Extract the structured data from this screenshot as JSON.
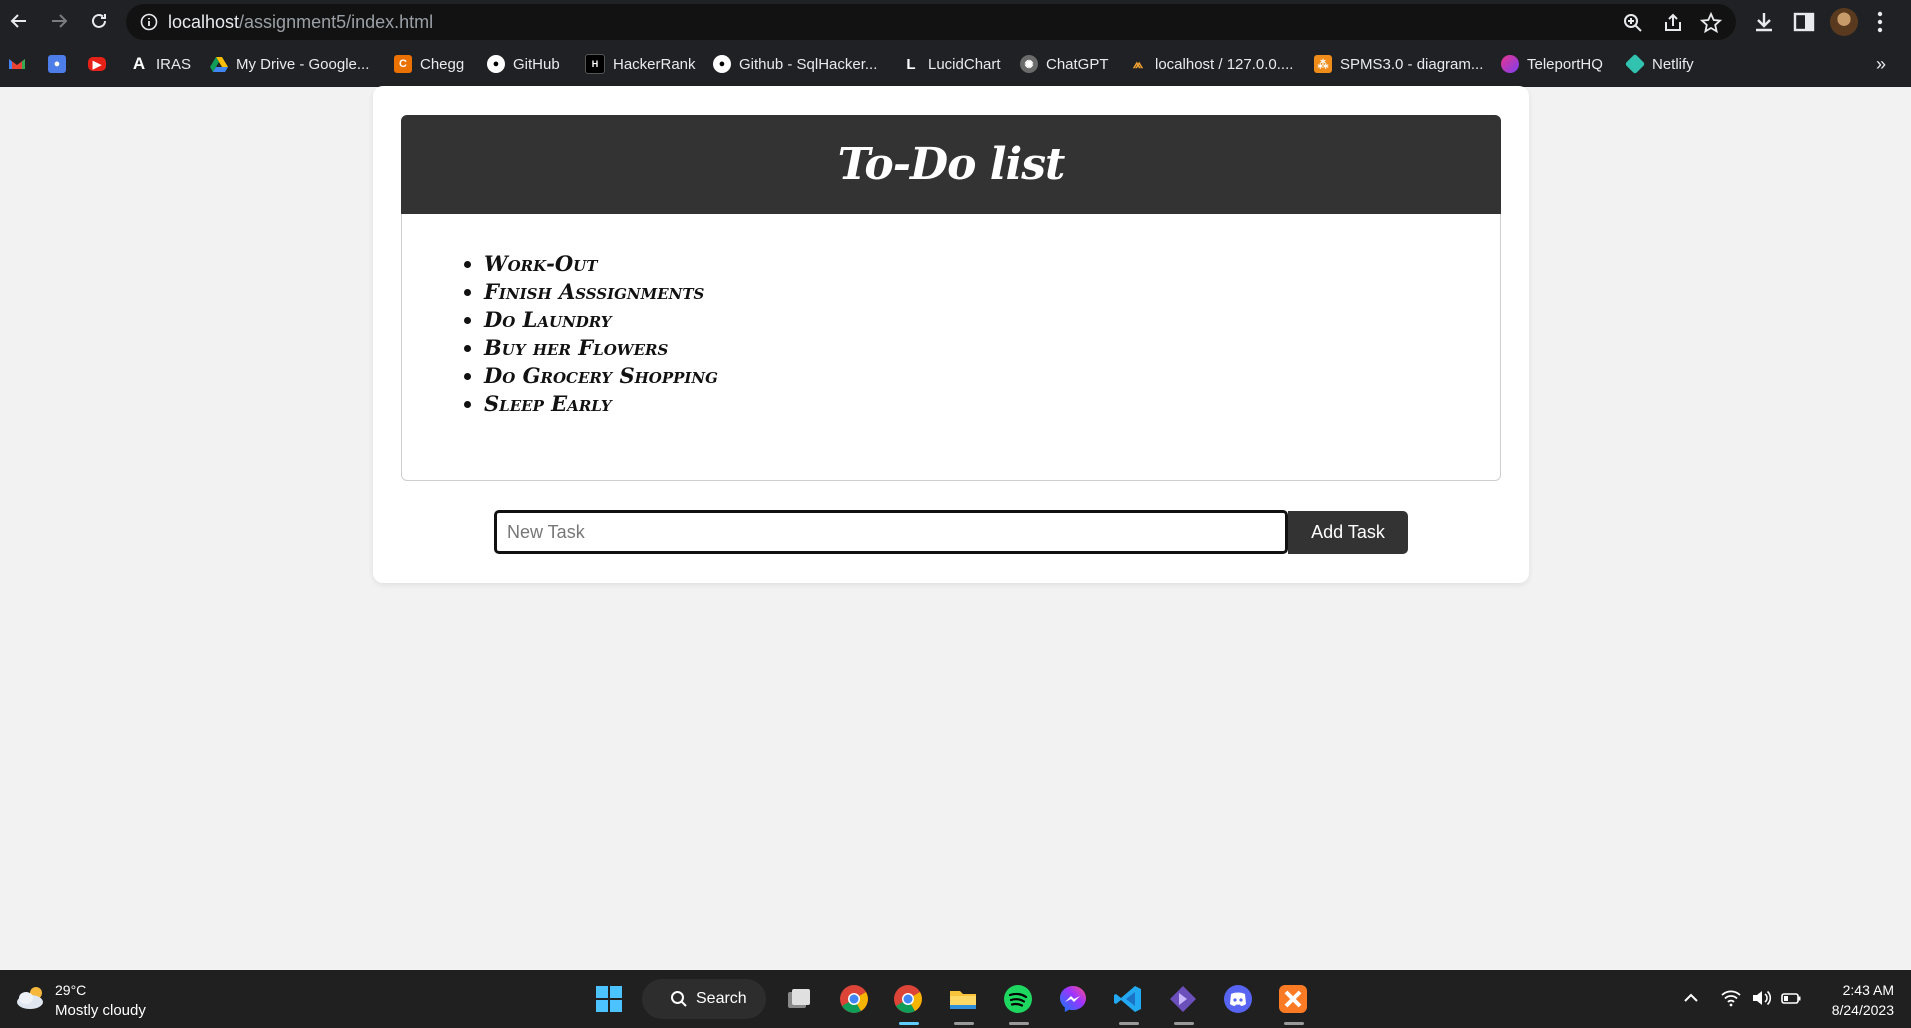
{
  "browser": {
    "url_host": "localhost",
    "url_path": "/assignment5/index.html",
    "bookmarks": [
      {
        "label": "",
        "icon": "gmail-icon"
      },
      {
        "label": "",
        "icon": "classroom-icon"
      },
      {
        "label": "",
        "icon": "youtube-icon"
      },
      {
        "label": "IRAS",
        "icon": "iras-icon"
      },
      {
        "label": "My Drive - Google...",
        "icon": "drive-icon"
      },
      {
        "label": "Chegg",
        "icon": "chegg-icon"
      },
      {
        "label": "GitHub",
        "icon": "github-icon"
      },
      {
        "label": "HackerRank",
        "icon": "hackerrank-icon"
      },
      {
        "label": "Github - SqlHacker...",
        "icon": "github-icon"
      },
      {
        "label": "LucidChart",
        "icon": "lucidchart-icon"
      },
      {
        "label": "ChatGPT",
        "icon": "chatgpt-icon"
      },
      {
        "label": "localhost / 127.0.0....",
        "icon": "phpmyadmin-icon"
      },
      {
        "label": "SPMS3.0 - diagram...",
        "icon": "diagram-icon"
      },
      {
        "label": "TeleportHQ",
        "icon": "teleporthq-icon"
      },
      {
        "label": "Netlify",
        "icon": "netlify-icon"
      }
    ],
    "more_bookmarks": "»"
  },
  "app": {
    "title": "To-Do list",
    "tasks": [
      "Work-Out",
      "Finish Asssignments",
      "Do Laundry",
      "Buy her Flowers",
      "Do Grocery Shopping",
      "Sleep Early"
    ],
    "input_placeholder": "New Task",
    "input_value": "",
    "add_button_label": "Add Task"
  },
  "taskbar": {
    "weather_temp": "29°C",
    "weather_desc": "Mostly cloudy",
    "search_label": "Search",
    "time": "2:43 AM",
    "date": "8/24/2023"
  },
  "colors": {
    "header_bg": "#333333",
    "page_bg": "#f2f2f2",
    "chrome_bg": "#202124"
  }
}
